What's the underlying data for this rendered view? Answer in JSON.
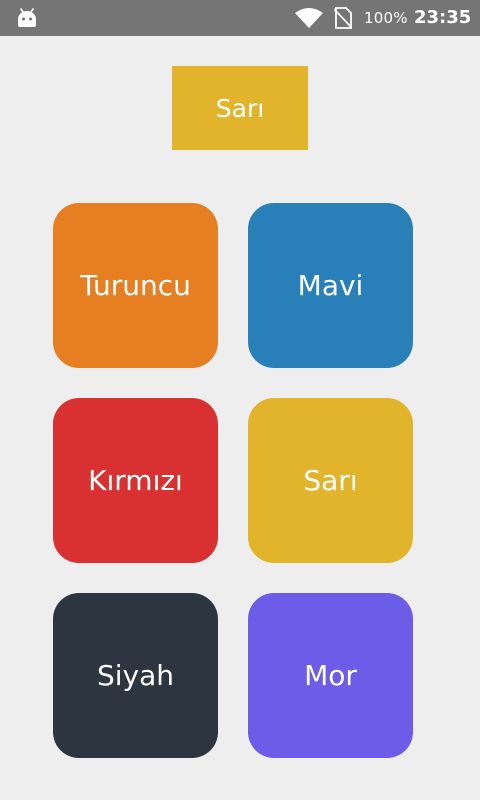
{
  "status_bar": {
    "left_icon": "android-icon",
    "icons": [
      "wifi-icon",
      "no-sim-icon"
    ],
    "battery": "100%",
    "time": "23:35"
  },
  "target": {
    "label": "Sarı",
    "color": "#e1b42b"
  },
  "tiles": [
    {
      "label": "Turuncu",
      "color": "#e67e22"
    },
    {
      "label": "Mavi",
      "color": "#2980b9"
    },
    {
      "label": "Kırmızı",
      "color": "#d93131"
    },
    {
      "label": "Sarı",
      "color": "#e1b42b"
    },
    {
      "label": "Siyah",
      "color": "#2d3540"
    },
    {
      "label": "Mor",
      "color": "#6c5ce7"
    }
  ]
}
